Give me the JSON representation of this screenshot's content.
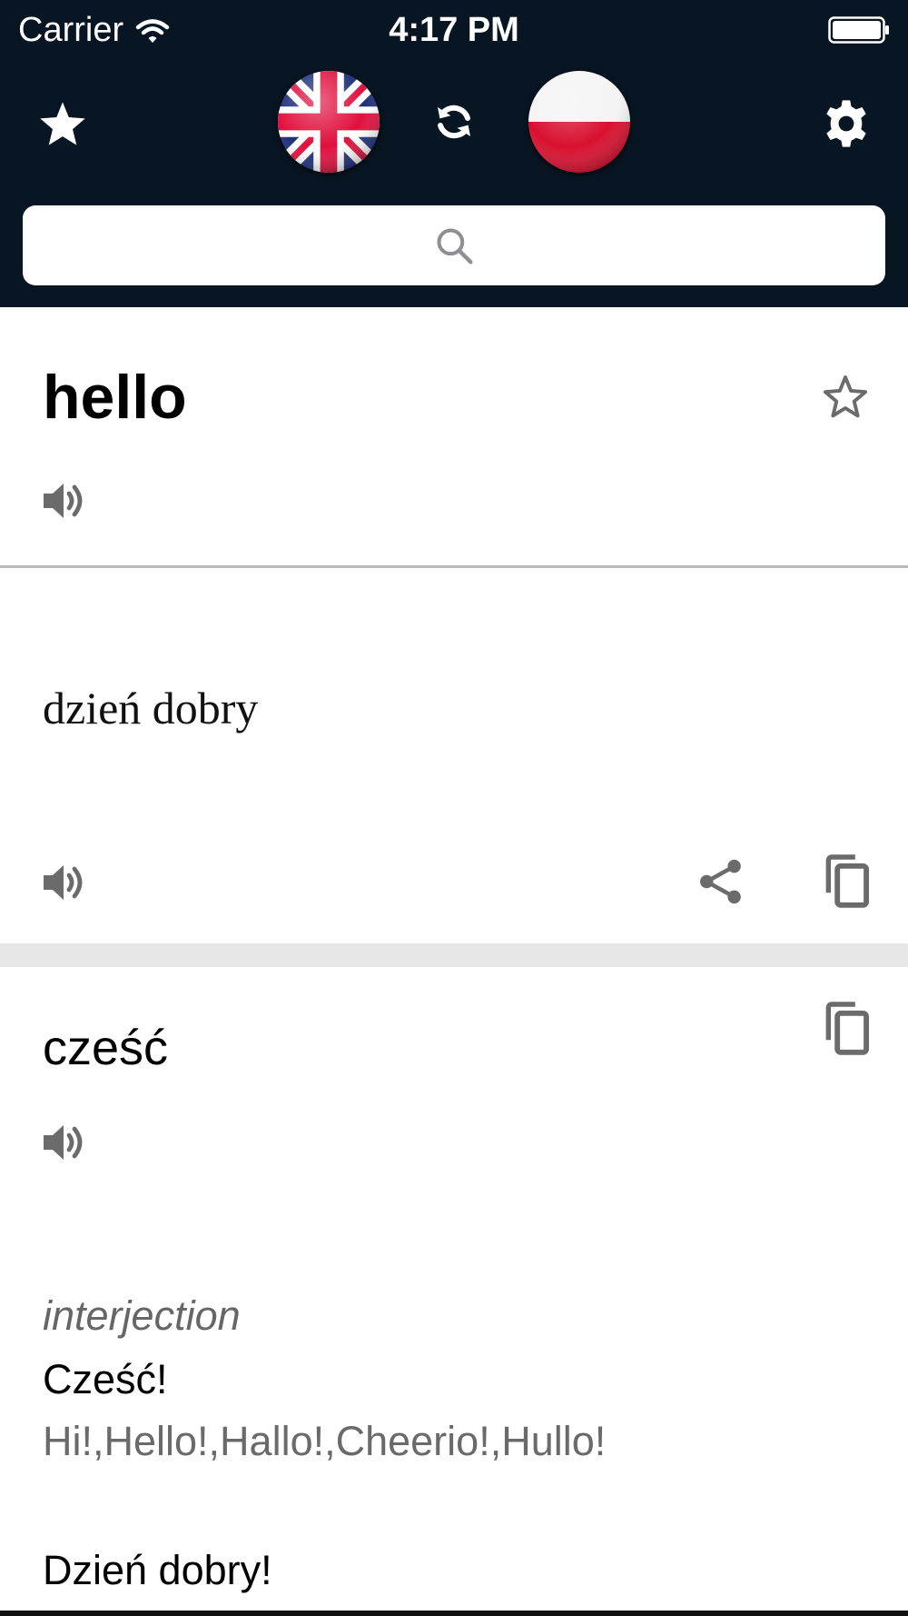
{
  "status_bar": {
    "carrier": "Carrier",
    "time": "4:17 PM"
  },
  "toolbar": {
    "favorites_icon": "star-filled-icon",
    "source_language_flag": "united-kingdom-flag-icon",
    "swap_icon": "swap-languages-icon",
    "target_language_flag": "poland-flag-icon",
    "settings_icon": "gear-icon"
  },
  "search": {
    "placeholder": "",
    "value": "",
    "icon": "search-icon"
  },
  "entry": {
    "word": "hello",
    "favorite_icon": "star-outline-icon",
    "speak_icon": "speaker-icon"
  },
  "translation": {
    "text": "dzień dobry",
    "speak_icon": "speaker-icon",
    "share_icon": "share-icon",
    "copy_icon": "copy-icon"
  },
  "dictionary": {
    "word": "cześć",
    "copy_icon": "copy-icon",
    "speak_icon": "speaker-icon",
    "part_of_speech": "interjection",
    "definitions": [
      {
        "term": "Cześć!",
        "synonyms": "Hi!,Hello!,Hallo!,Cheerio!,Hullo!"
      },
      {
        "term": "Dzień dobry!"
      }
    ]
  },
  "colors": {
    "header_bg": "#081522",
    "icon_gray": "#6b6b6b",
    "divider": "#b8b8b8",
    "band": "#e6e6e6"
  }
}
